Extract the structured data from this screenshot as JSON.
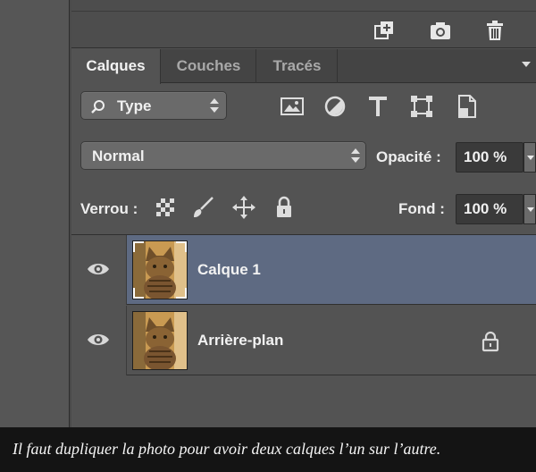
{
  "toolbar": {
    "icons": [
      "new-layer-icon",
      "camera-icon",
      "trash-icon"
    ]
  },
  "tabs": [
    {
      "label": "Calques",
      "active": true
    },
    {
      "label": "Couches",
      "active": false
    },
    {
      "label": "Tracés",
      "active": false
    }
  ],
  "filter": {
    "type_label": "Type",
    "icons": [
      "image-filter-icon",
      "adjustment-filter-icon",
      "text-filter-icon",
      "shape-filter-icon",
      "smart-object-filter-icon"
    ]
  },
  "blend": {
    "mode": "Normal",
    "opacity_label": "Opacité :",
    "opacity_value": "100 %"
  },
  "lock": {
    "label": "Verrou :",
    "icons": [
      "lock-transparency-icon",
      "lock-paint-icon",
      "lock-position-icon",
      "lock-all-icon"
    ],
    "fill_label": "Fond :",
    "fill_value": "100 %"
  },
  "layers": [
    {
      "name": "Calque 1",
      "selected": true,
      "locked": false
    },
    {
      "name": "Arrière-plan",
      "selected": false,
      "locked": true
    }
  ],
  "caption": "Il faut dupliquer la photo pour avoir deux calques l’un sur l’autre.",
  "colors": {
    "panel_bg": "#535353",
    "selected_row": "#5e6a82",
    "caption_bg": "#141414"
  }
}
